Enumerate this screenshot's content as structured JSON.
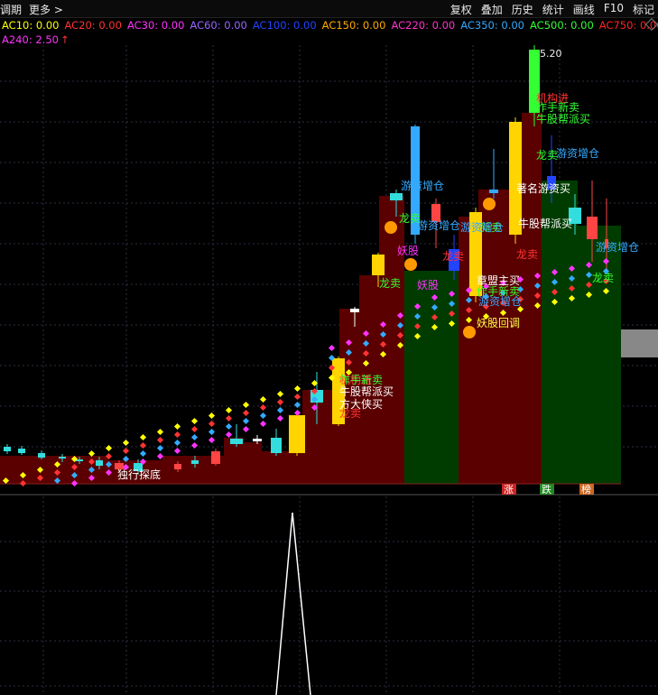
{
  "toolbar": {
    "left": [
      "调期",
      "更多 >"
    ],
    "right": [
      "复权",
      "叠加",
      "历史",
      "统计",
      "画线",
      "F10",
      "标记"
    ]
  },
  "ma_lines": [
    {
      "label": "AC10: 0.00",
      "color": "#ffff00"
    },
    {
      "label": "AC20: 0.00",
      "color": "#ff3333"
    },
    {
      "label": "AC30: 0.00",
      "color": "#ff33ff"
    },
    {
      "label": "AC60: 0.00",
      "color": "#9966ff"
    },
    {
      "label": "AC100: 0.00",
      "color": "#2244ff"
    },
    {
      "label": "AC150: 0.00",
      "color": "#ffaa00"
    },
    {
      "label": "AC220: 0.00",
      "color": "#ff33cc"
    },
    {
      "label": "AC350: 0.00",
      "color": "#33aaff"
    },
    {
      "label": "AC500: 0.00",
      "color": "#33ff33"
    },
    {
      "label": "AC750: 0.00",
      "color": "#ff2222"
    }
  ],
  "ma_row2": {
    "label": "A240: 2.50",
    "arrow": "↑",
    "color": "#ff33ff"
  },
  "price_tag": "5.20",
  "annotations": [
    {
      "text": "机构进",
      "color": "#ff3333"
    },
    {
      "text": "作手新卖",
      "color": "#33ff33"
    },
    {
      "text": "牛股帮派买",
      "color": "#33ff33"
    },
    {
      "text": "龙卖",
      "color": "#33ff33"
    },
    {
      "text": "游资增仓",
      "color": "#33aaff"
    },
    {
      "text": "游资增仓",
      "color": "#33aaff"
    },
    {
      "text": "游资增仓",
      "color": "#33aaff"
    },
    {
      "text": "著名游资买",
      "color": "#ffffff"
    },
    {
      "text": "牛股帮派买",
      "color": "#ffffff"
    },
    {
      "text": "龙卖",
      "color": "#ff3333"
    },
    {
      "text": "龙卖",
      "color": "#33ff33"
    },
    {
      "text": "龙卖",
      "color": "#ff3333"
    },
    {
      "text": "妖股",
      "color": "#ff33ff"
    },
    {
      "text": "妖股",
      "color": "#ff33ff"
    },
    {
      "text": "龙卖",
      "color": "#33ff33"
    },
    {
      "text": "游资增仓",
      "color": "#33aaff"
    },
    {
      "text": "新卖",
      "color": "#33ff33"
    },
    {
      "text": "游资增仓",
      "color": "#33aaff"
    },
    {
      "text": "章盟主买",
      "color": "#ffffff"
    },
    {
      "text": "作手新卖",
      "color": "#33ff33"
    },
    {
      "text": "游资增仓",
      "color": "#33aaff"
    },
    {
      "text": "妖股回调",
      "color": "#ffff44"
    },
    {
      "text": "机构进",
      "color": "#ff3333"
    },
    {
      "text": "作手新卖",
      "color": "#33ff33"
    },
    {
      "text": "牛股帮派买",
      "color": "#ffffff"
    },
    {
      "text": "方大侠买",
      "color": "#ffffff"
    },
    {
      "text": "龙卖",
      "color": "#ff3333"
    },
    {
      "text": "独行探底",
      "color": "#ffffff"
    },
    {
      "text": "龙卖",
      "color": "#33ff33"
    }
  ],
  "bottom_badges": [
    {
      "text": "涨",
      "bg": "#cc2222"
    },
    {
      "text": "跌",
      "bg": "#228822"
    },
    {
      "text": "榜",
      "bg": "#cc6622"
    }
  ]
}
